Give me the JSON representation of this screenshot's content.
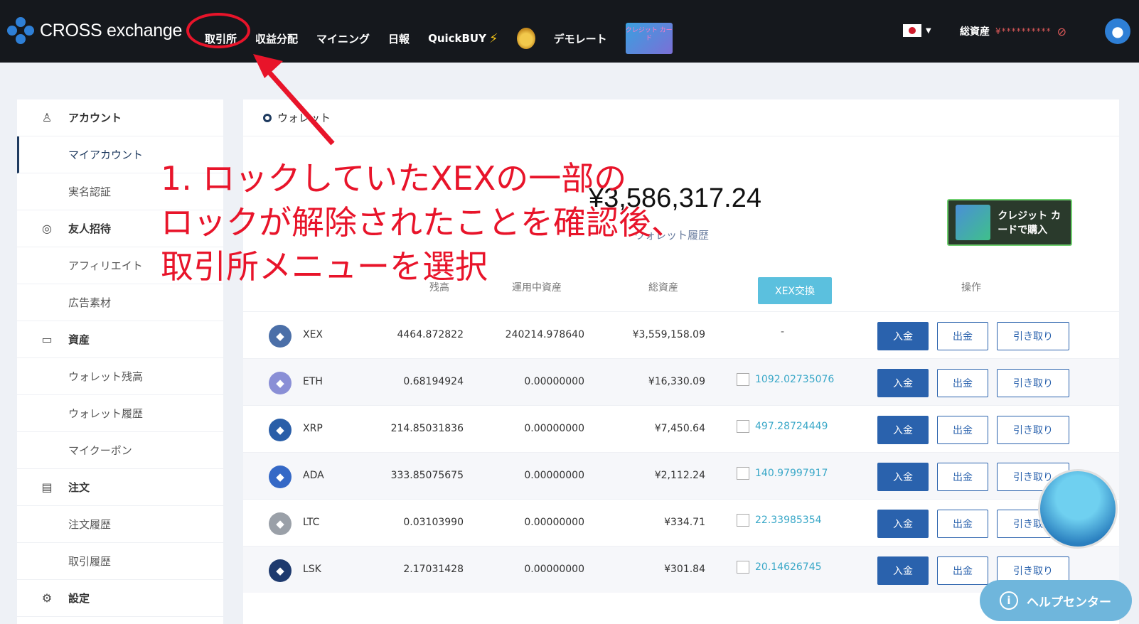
{
  "header": {
    "logo_text": "CROSS exchange",
    "nav": [
      {
        "label": "取引所",
        "id": "exchange"
      },
      {
        "label": "収益分配",
        "id": "revenue"
      },
      {
        "label": "マイニング",
        "id": "mining"
      },
      {
        "label": "日報",
        "id": "daily"
      },
      {
        "label": "QuickBUY",
        "id": "quickbuy"
      },
      {
        "label": "デモレート",
        "id": "demo"
      }
    ],
    "credit_banner": "クレジット カード",
    "total_assets_label": "総資産",
    "total_assets_hidden": "¥**********"
  },
  "sidebar": {
    "items": [
      {
        "label": "アカウント",
        "type": "section",
        "icon": "user-icon"
      },
      {
        "label": "マイアカウント",
        "type": "sub"
      },
      {
        "label": "実名認証",
        "type": "sub"
      },
      {
        "label": "友人招待",
        "type": "section",
        "icon": "coin-icon"
      },
      {
        "label": "アフィリエイト",
        "type": "sub"
      },
      {
        "label": "広告素材",
        "type": "sub"
      },
      {
        "label": "資産",
        "type": "section",
        "icon": "folder-icon"
      },
      {
        "label": "ウォレット残高",
        "type": "sub"
      },
      {
        "label": "ウォレット履歴",
        "type": "sub"
      },
      {
        "label": "マイクーポン",
        "type": "sub"
      },
      {
        "label": "注文",
        "type": "section",
        "icon": "document-icon"
      },
      {
        "label": "注文履歴",
        "type": "sub"
      },
      {
        "label": "取引履歴",
        "type": "sub"
      },
      {
        "label": "設定",
        "type": "section",
        "icon": "gear-icon"
      }
    ]
  },
  "main": {
    "title": "ウォレット",
    "total_balance": "¥3,586,317.24",
    "history_link": "ウォレット履歴",
    "buy_button": "クレジット カードで購入",
    "columns": {
      "balance": "残高",
      "in_use": "運用中資産",
      "total": "総資産",
      "xex_exchange": "XEX交換",
      "action": "操作"
    },
    "buttons": {
      "deposit": "入金",
      "withdraw": "出金",
      "pull": "引き取り"
    },
    "rows": [
      {
        "symbol": "XEX",
        "balance": "4464.872822",
        "in_use": "240214.978640",
        "total": "¥3,559,158.09",
        "xex": "-",
        "icon_color": "#4b6fa8"
      },
      {
        "symbol": "ETH",
        "balance": "0.68194924",
        "in_use": "0.00000000",
        "total": "¥16,330.09",
        "xex": "1092.02735076",
        "icon_color": "#8a8fd6"
      },
      {
        "symbol": "XRP",
        "balance": "214.85031836",
        "in_use": "0.00000000",
        "total": "¥7,450.64",
        "xex": "497.28724449",
        "icon_color": "#2a5ea8"
      },
      {
        "symbol": "ADA",
        "balance": "333.85075675",
        "in_use": "0.00000000",
        "total": "¥2,112.24",
        "xex": "140.97997917",
        "icon_color": "#3468c6"
      },
      {
        "symbol": "LTC",
        "balance": "0.03103990",
        "in_use": "0.00000000",
        "total": "¥334.71",
        "xex": "22.33985354",
        "icon_color": "#9aa0a8"
      },
      {
        "symbol": "LSK",
        "balance": "2.17031428",
        "in_use": "0.00000000",
        "total": "¥301.84",
        "xex": "20.14626745",
        "icon_color": "#1e3a6e"
      }
    ]
  },
  "annotation": {
    "lines": [
      "1. ロックしていたXEXの一部の",
      "ロックが解除されたことを確認後、",
      "取引所メニューを選択"
    ]
  },
  "help": {
    "label": "ヘルプセンター"
  }
}
